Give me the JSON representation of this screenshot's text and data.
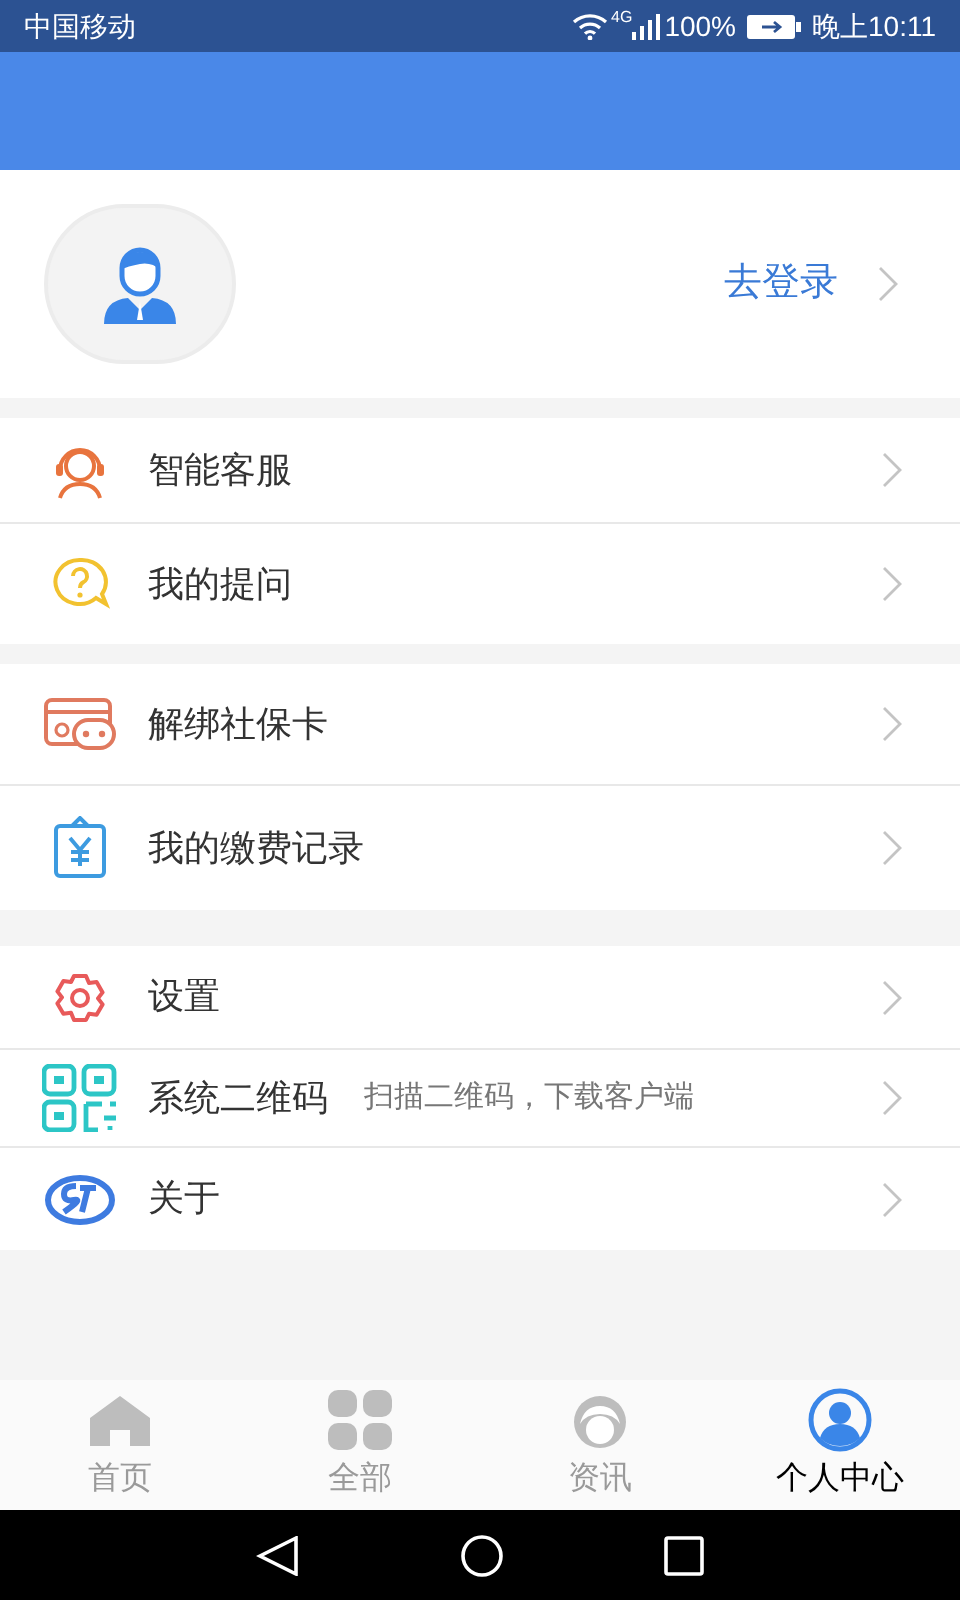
{
  "status_bar": {
    "carrier": "中国移动",
    "network": "4G",
    "battery": "100%",
    "time": "晚上10:11"
  },
  "profile": {
    "login_link": "去登录"
  },
  "menu_groups": [
    [
      {
        "label": "智能客服"
      },
      {
        "label": "我的提问"
      }
    ],
    [
      {
        "label": "解绑社保卡"
      },
      {
        "label": "我的缴费记录"
      }
    ],
    [
      {
        "label": "设置"
      },
      {
        "label": "系统二维码",
        "hint": "扫描二维码，下载客户端"
      },
      {
        "label": "关于"
      }
    ]
  ],
  "tabs": [
    {
      "label": "首页",
      "selected": false
    },
    {
      "label": "全部",
      "selected": false
    },
    {
      "label": "资讯",
      "selected": false
    },
    {
      "label": "个人中心",
      "selected": true
    }
  ]
}
